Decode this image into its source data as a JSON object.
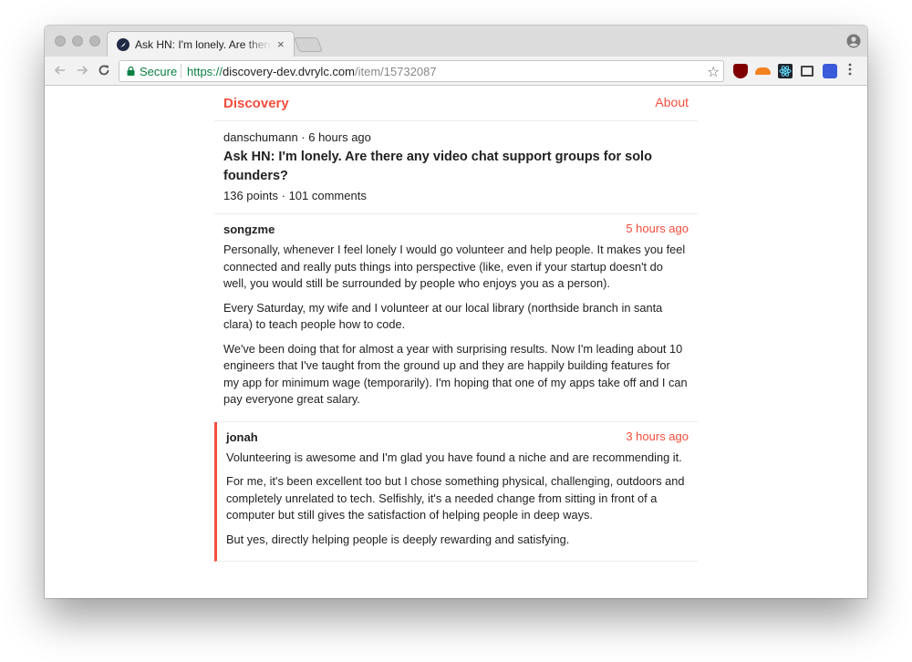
{
  "browser": {
    "tab_title": "Ask HN: I'm lonely. Are there any video chat support groups for solo founders?",
    "tab_close": "×",
    "secure_label": "Secure",
    "url_scheme": "https://",
    "url_host": "discovery-dev.dvrylc.com",
    "url_path": "/item/15732087",
    "accent_secure": "#0b8043"
  },
  "site": {
    "brand": "Discovery",
    "about": "About",
    "accent": "#f24e3c"
  },
  "story": {
    "author": "danschumann",
    "age": "6 hours ago",
    "meta_sep": " · ",
    "title": "Ask HN: I'm lonely. Are there any video chat support groups for solo founders?",
    "points": "136 points",
    "comments": "101 comments"
  },
  "comments": [
    {
      "author": "songzme",
      "time": "5 hours ago",
      "paragraphs": [
        "Personally, whenever I feel lonely I would go volunteer and help people. It makes you feel connected and really puts things into perspective (like, even if your startup doesn't do well, you would still be surrounded by people who enjoys you as a person).",
        "Every Saturday, my wife and I volunteer at our local library (northside branch in santa clara) to teach people how to code.",
        "We've been doing that for almost a year with surprising results. Now I'm leading about 10 engineers that I've taught from the ground up and they are happily building features for my app for minimum wage (temporarily). I'm hoping that one of my apps take off and I can pay everyone great salary."
      ]
    },
    {
      "author": "jonah",
      "time": "3 hours ago",
      "paragraphs": [
        "Volunteering is awesome and I'm glad you have found a niche and are recommending it.",
        "For me, it's been excellent too but I chose something physical, challenging, outdoors and completely unrelated to tech. Selfishly, it's a needed change from sitting in front of a computer but still gives the satisfaction of helping people in deep ways.",
        "But yes, directly helping people is deeply rewarding and satisfying."
      ]
    }
  ],
  "icons": {
    "back": "arrow-left",
    "forward": "arrow-right",
    "reload": "reload",
    "lock": "lock",
    "star": "star",
    "profile": "profile",
    "menu": "kebab-menu"
  }
}
